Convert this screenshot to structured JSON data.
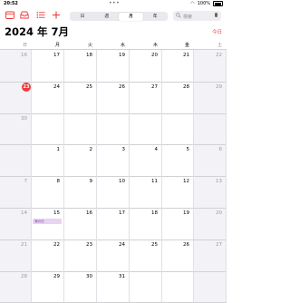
{
  "status": {
    "time": "20:52",
    "battery": "100%"
  },
  "toolbar": {
    "segments": [
      "日",
      "週",
      "月",
      "年"
    ],
    "active_segment": "月",
    "search_placeholder": "検索"
  },
  "header": {
    "title": "2024 年 7月",
    "today_label": "今日"
  },
  "weekdays": [
    "日",
    "月",
    "火",
    "水",
    "木",
    "金",
    "土"
  ],
  "weeks": [
    [
      {
        "d": "16",
        "m": true
      },
      {
        "d": "17"
      },
      {
        "d": "18"
      },
      {
        "d": "19"
      },
      {
        "d": "20"
      },
      {
        "d": "21"
      },
      {
        "d": "22",
        "m": true
      }
    ],
    [
      {
        "d": "23",
        "today": true
      },
      {
        "d": "24"
      },
      {
        "d": "25"
      },
      {
        "d": "26"
      },
      {
        "d": "27"
      },
      {
        "d": "28"
      },
      {
        "d": "29",
        "m": true
      }
    ],
    [
      {
        "d": "30",
        "m": true
      },
      {
        "d": ""
      },
      {
        "d": ""
      },
      {
        "d": ""
      },
      {
        "d": ""
      },
      {
        "d": ""
      },
      {
        "d": ""
      }
    ],
    [
      {
        "d": ""
      },
      {
        "d": "1"
      },
      {
        "d": "2"
      },
      {
        "d": "3"
      },
      {
        "d": "4"
      },
      {
        "d": "5"
      },
      {
        "d": "6",
        "m": true
      }
    ],
    [
      {
        "d": "7",
        "m": true
      },
      {
        "d": "8"
      },
      {
        "d": "9"
      },
      {
        "d": "10"
      },
      {
        "d": "11"
      },
      {
        "d": "12"
      },
      {
        "d": "13",
        "m": true
      }
    ],
    [
      {
        "d": "14",
        "m": true
      },
      {
        "d": "15"
      },
      {
        "d": "16"
      },
      {
        "d": "17"
      },
      {
        "d": "18"
      },
      {
        "d": "19"
      },
      {
        "d": "20",
        "m": true
      }
    ],
    [
      {
        "d": "21",
        "m": true
      },
      {
        "d": "22"
      },
      {
        "d": "23"
      },
      {
        "d": "24"
      },
      {
        "d": "25"
      },
      {
        "d": "26"
      },
      {
        "d": "27",
        "m": true
      }
    ],
    [
      {
        "d": "28",
        "m": true
      },
      {
        "d": "29"
      },
      {
        "d": "30"
      },
      {
        "d": "31"
      },
      {
        "d": ""
      },
      {
        "d": ""
      },
      {
        "d": ""
      }
    ]
  ],
  "events": [
    {
      "label": "海の日"
    }
  ],
  "colors": {
    "accent": "#f03a3a",
    "event_bg": "#e8d3f3",
    "weekend_bg": "#f2f2f7"
  }
}
